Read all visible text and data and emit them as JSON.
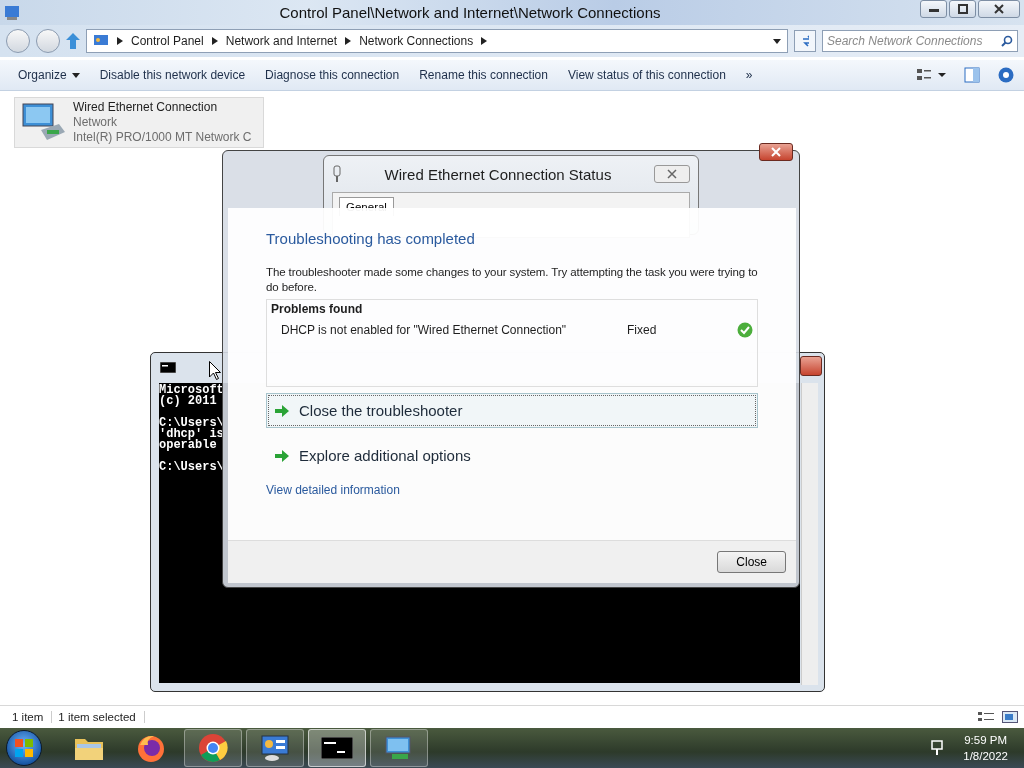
{
  "explorer": {
    "title": "Control Panel\\Network and Internet\\Network Connections",
    "breadcrumb": [
      "Control Panel",
      "Network and Internet",
      "Network Connections"
    ],
    "search": {
      "placeholder": "Search Network Connections"
    },
    "toolbar": [
      {
        "label": "Organize",
        "kind": "menu"
      },
      {
        "label": "Disable this network device",
        "kind": "action"
      },
      {
        "label": "Diagnose this connection",
        "kind": "action"
      },
      {
        "label": "Rename this connection",
        "kind": "action"
      },
      {
        "label": "View status of this connection",
        "kind": "action"
      },
      {
        "label": "»",
        "kind": "more"
      }
    ],
    "items": [
      {
        "name": "Wired Ethernet Connection",
        "status": "Network",
        "adapter": "Intel(R) PRO/1000 MT Network C",
        "selected": true
      }
    ],
    "status_bar": [
      "1 item",
      "1 item selected"
    ]
  },
  "cmd": {
    "blocks": [
      [
        "Microsoft",
        "(c) 2011"
      ],
      [
        "C:\\Users\\",
        "'dhcp' is",
        "operable"
      ],
      [
        "C:\\Users\\"
      ]
    ]
  },
  "status_window": {
    "title": "Wired Ethernet Connection Status",
    "tabs": [
      {
        "label": "General",
        "selected": true
      }
    ]
  },
  "troubleshooter": {
    "heading": "Troubleshooting has completed",
    "message": "The troubleshooter made some changes to your system. Try attempting the task you were trying to do before.",
    "problems_header": "Problems found",
    "problems": [
      {
        "text": "DHCP is not enabled for \"Wired Ethernet Connection\"",
        "status": "Fixed",
        "fixed": true
      }
    ],
    "actions": [
      {
        "label": "Close the troubleshooter",
        "selected": true
      },
      {
        "label": "Explore additional options",
        "selected": false
      }
    ],
    "link": "View detailed information",
    "button": "Close"
  },
  "taskbar": {
    "apps": [
      {
        "kind": "folder",
        "running": false,
        "selected": false
      },
      {
        "kind": "firefox",
        "running": false,
        "selected": false
      },
      {
        "kind": "chrome",
        "running": true,
        "selected": false
      },
      {
        "kind": "control-panel",
        "running": true,
        "selected": false
      },
      {
        "kind": "console",
        "running": true,
        "selected": true
      },
      {
        "kind": "network",
        "running": true,
        "selected": false
      }
    ],
    "time": "9:59 PM",
    "date": "1/8/2022"
  }
}
